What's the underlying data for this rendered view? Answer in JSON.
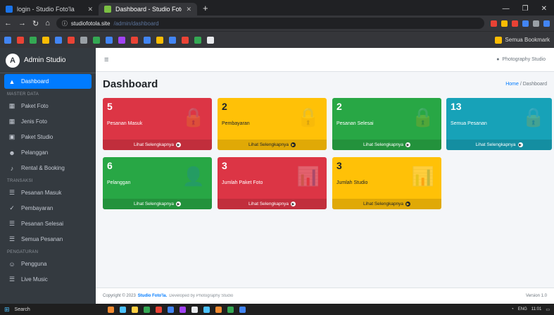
{
  "browser": {
    "tabs": [
      {
        "title": "login - Studio Foto'la",
        "active": false
      },
      {
        "title": "Dashboard - Studio Foto'la",
        "active": true
      }
    ],
    "new_tab": "+",
    "url_host": "studiofotola.site",
    "url_path": "/admin/dashboard",
    "bookmark_right": "Semua Bookmark"
  },
  "sidebar": {
    "brand": "Admin Studio",
    "items": [
      {
        "type": "item",
        "icon": "▲",
        "icon_name": "dashboard-icon",
        "label": "Dashboard",
        "active": true
      },
      {
        "type": "header",
        "label": "MASTER DATA"
      },
      {
        "type": "item",
        "icon": "▦",
        "icon_name": "table-icon",
        "label": "Paket Foto"
      },
      {
        "type": "item",
        "icon": "▦",
        "icon_name": "table-icon",
        "label": "Jenis Foto"
      },
      {
        "type": "item",
        "icon": "▣",
        "icon_name": "table-icon",
        "label": "Paket Studio"
      },
      {
        "type": "item",
        "icon": "☻",
        "icon_name": "users-icon",
        "label": "Pelanggan"
      },
      {
        "type": "item",
        "icon": "♪",
        "icon_name": "music-icon",
        "label": "Rental & Booking"
      },
      {
        "type": "header",
        "label": "TRANSAKSI"
      },
      {
        "type": "item",
        "icon": "☰",
        "icon_name": "list-icon",
        "label": "Pesanan Masuk"
      },
      {
        "type": "item",
        "icon": "✓",
        "icon_name": "check-icon",
        "label": "Pembayaran"
      },
      {
        "type": "item",
        "icon": "☰",
        "icon_name": "list-icon",
        "label": "Pesanan Selesai"
      },
      {
        "type": "item",
        "icon": "☰",
        "icon_name": "list-icon",
        "label": "Semua Pesanan"
      },
      {
        "type": "header",
        "label": "PENGATURAN"
      },
      {
        "type": "item",
        "icon": "☺",
        "icon_name": "user-icon",
        "label": "Pengguna"
      },
      {
        "type": "item",
        "icon": "☰",
        "icon_name": "list-icon",
        "label": "Live Music"
      }
    ]
  },
  "topnav": {
    "menu_icon": "≡",
    "user_label": "Photography Studio"
  },
  "header": {
    "title": "Dashboard",
    "breadcrumb_home": "Home",
    "breadcrumb_sep": "/",
    "breadcrumb_current": "Dashboard"
  },
  "boxes": [
    {
      "value": "5",
      "label": "Pesanan Masuk",
      "footer": "Lihat Selengkapnya",
      "color": "#dc3545",
      "icon": "🔒"
    },
    {
      "value": "2",
      "label": "Pembayaran",
      "footer": "Lihat Selengkapnya",
      "color": "#ffc107",
      "icon": "🔒"
    },
    {
      "value": "2",
      "label": "Pesanan Selesai",
      "footer": "Lihat Selengkapnya",
      "color": "#28a745",
      "icon": "🔒"
    },
    {
      "value": "13",
      "label": "Semua Pesanan",
      "footer": "Lihat Selengkapnya",
      "color": "#17a2b8",
      "icon": "🔒"
    },
    {
      "value": "6",
      "label": "Pelanggan",
      "footer": "Lihat Selengkapnya",
      "color": "#28a745",
      "icon": "👤"
    },
    {
      "value": "3",
      "label": "Jumlah Paket Foto",
      "footer": "Lihat Selengkapnya",
      "color": "#dc3545",
      "icon": "📊"
    },
    {
      "value": "3",
      "label": "Jumlah Studio",
      "footer": "Lihat Selengkapnya",
      "color": "#ffc107",
      "icon": "📊"
    }
  ],
  "footer": {
    "copyright": "Copyright © 2023",
    "brand": "Studio Foto'la.",
    "developer": "Developed by Photography Studio",
    "version": "Version 1.0"
  },
  "taskbar": {
    "search": "Search",
    "time": "11:01",
    "lang": "ENG"
  }
}
